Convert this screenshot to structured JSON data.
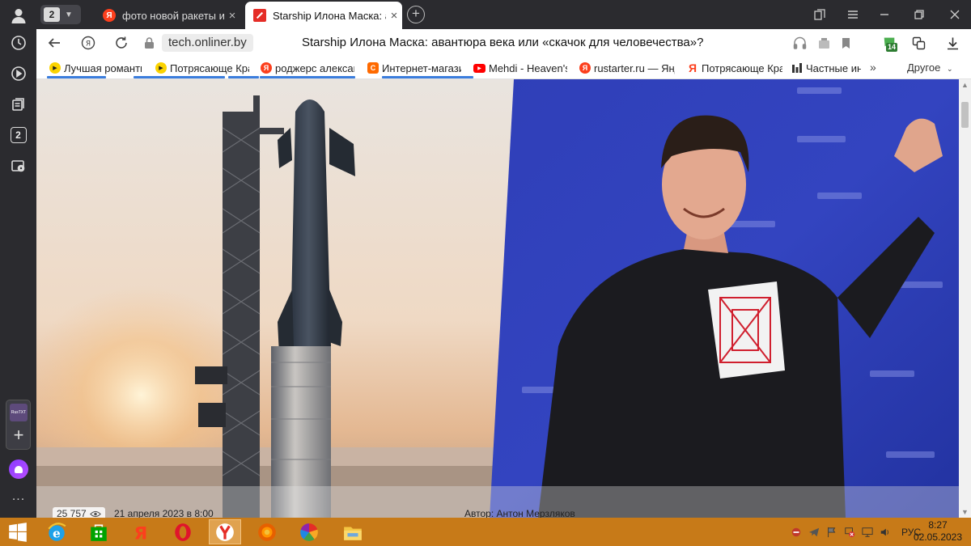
{
  "tabs": {
    "count": "2",
    "inactive_title": "фото новой ракеты илона",
    "active_title": "Starship Илона Маска: авантюра века или «скачок для человечества»?"
  },
  "address": {
    "host": "tech.onliner.by",
    "page_title": "Starship Илона Маска: авантюра века или «скачок для человечества»?",
    "extension_badge": "14"
  },
  "sidebar": {
    "tab_badge": "2",
    "widget_label": "RusTXT"
  },
  "bookmarks": {
    "items": [
      {
        "label": "Лучшая романтическая",
        "icon": "play-icon"
      },
      {
        "label": "Потрясающе Красивая",
        "icon": "play-icon"
      },
      {
        "label": "роджерс александр",
        "icon": "yandex-icon"
      },
      {
        "label": "Интернет-магазин",
        "icon": "shop-icon"
      },
      {
        "label": "Mehdi - Heaven's Door",
        "icon": "youtube-icon"
      },
      {
        "label": "rustarter.ru — Яндекс",
        "icon": "yandex-icon"
      },
      {
        "label": "Потрясающе Красивая",
        "icon": "yandex-letter-icon"
      },
      {
        "label": "Частные инвестиции",
        "icon": "bars-icon"
      }
    ],
    "more": "»",
    "other": "Другое"
  },
  "article": {
    "views": "25 757",
    "date": "21 апреля 2023 в 8:00",
    "author": "Автор: Антон Мерзляков"
  },
  "taskbar": {
    "lang": "РУС",
    "time": "8:27",
    "date": "02.05.2023"
  }
}
